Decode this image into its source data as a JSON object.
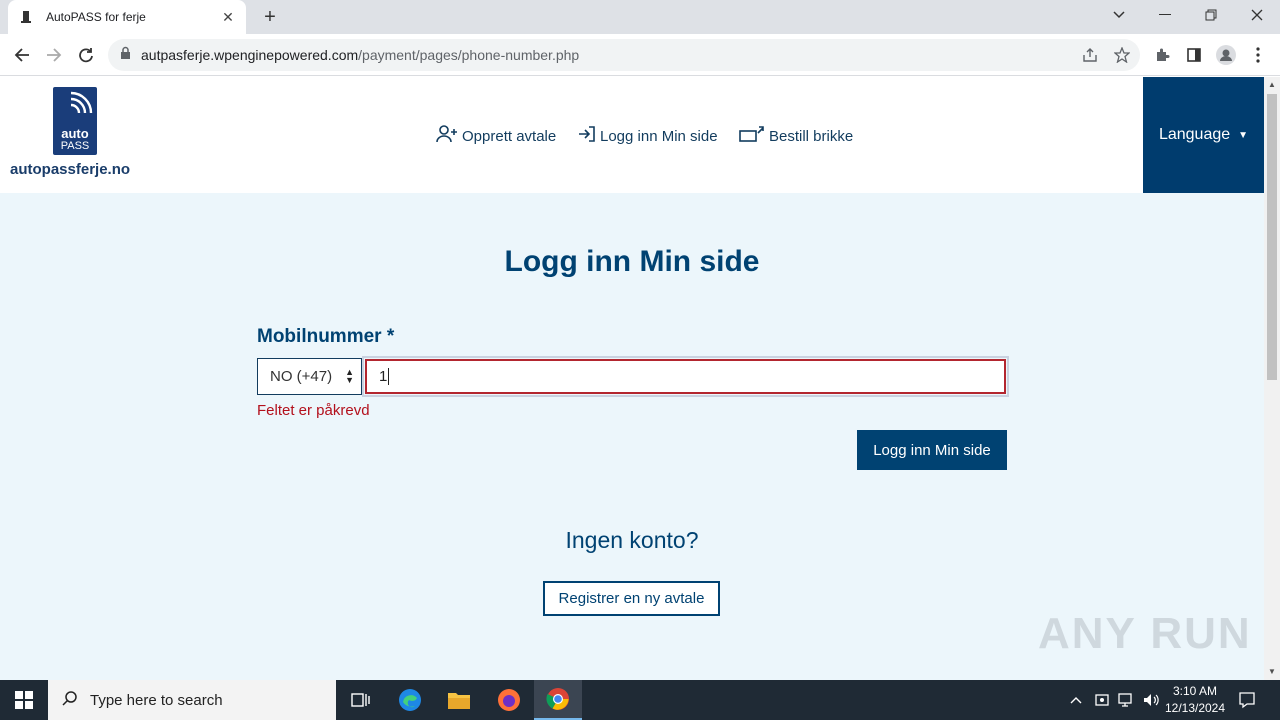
{
  "browser": {
    "tab_title": "AutoPASS for ferje",
    "url_domain": "autpasferje.wpenginepowered.com",
    "url_path": "/payment/pages/phone-number.php"
  },
  "header": {
    "logo_line1": "auto",
    "logo_line2": "PASS",
    "site_name": "autopassferje.no",
    "nav": {
      "create": "Opprett avtale",
      "login": "Logg inn Min side",
      "order": "Bestill brikke"
    },
    "language": "Language"
  },
  "main": {
    "title": "Logg inn Min side",
    "field_label": "Mobilnummer *",
    "country_code": "NO (+47)",
    "phone_value": "1",
    "error": "Feltet er påkrevd",
    "login_button": "Logg inn Min side",
    "no_account": "Ingen konto?",
    "register_button": "Registrer en ny avtale"
  },
  "watermark": "ANY RUN",
  "taskbar": {
    "search_placeholder": "Type here to search",
    "time": "3:10 AM",
    "date": "12/13/2024"
  },
  "colors": {
    "brand": "#004272",
    "error": "#b3101c",
    "page_bg": "#ecf6fb"
  }
}
